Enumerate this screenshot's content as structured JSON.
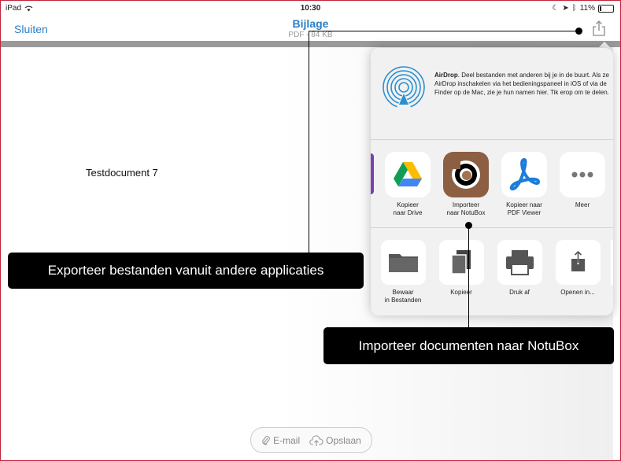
{
  "status": {
    "device": "iPad",
    "time": "10:30",
    "battery": "11%"
  },
  "nav": {
    "close": "Sluiten",
    "title": "Bijlage",
    "subtitle": "PDF - 84 KB"
  },
  "document": {
    "text": "Testdocument 7"
  },
  "share_sheet": {
    "airdrop_title": "AirDrop",
    "airdrop_body": ". Deel bestanden met anderen bij je in de buurt. Als ze AirDrop inschakelen via het bedieningspaneel in iOS of via de Finder op de Mac, zie je hun namen hier. Tik erop om te delen.",
    "apps": [
      {
        "label": "Kopieer\nnaar Drive",
        "icon": "google-drive-icon"
      },
      {
        "label": "Importeer\nnaar NotuBox",
        "icon": "notubox-icon"
      },
      {
        "label": "Kopieer naar\nPDF Viewer",
        "icon": "pdf-viewer-icon"
      },
      {
        "label": "Meer",
        "icon": "more-icon"
      }
    ],
    "actions": [
      {
        "label": "Bewaar\nin Bestanden",
        "icon": "folder-icon"
      },
      {
        "label": "Kopieer",
        "icon": "copy-icon"
      },
      {
        "label": "Druk af",
        "icon": "printer-icon"
      },
      {
        "label": "Openen in...",
        "icon": "open-in-icon"
      }
    ]
  },
  "callouts": {
    "export": "Exporteer bestanden vanuit andere applicaties",
    "import": "Importeer documenten naar NotuBox"
  },
  "bottom": {
    "email": "E-mail",
    "save": "Opslaan"
  },
  "colors": {
    "accent": "#2a7fc6",
    "frame": "#c0243a"
  }
}
